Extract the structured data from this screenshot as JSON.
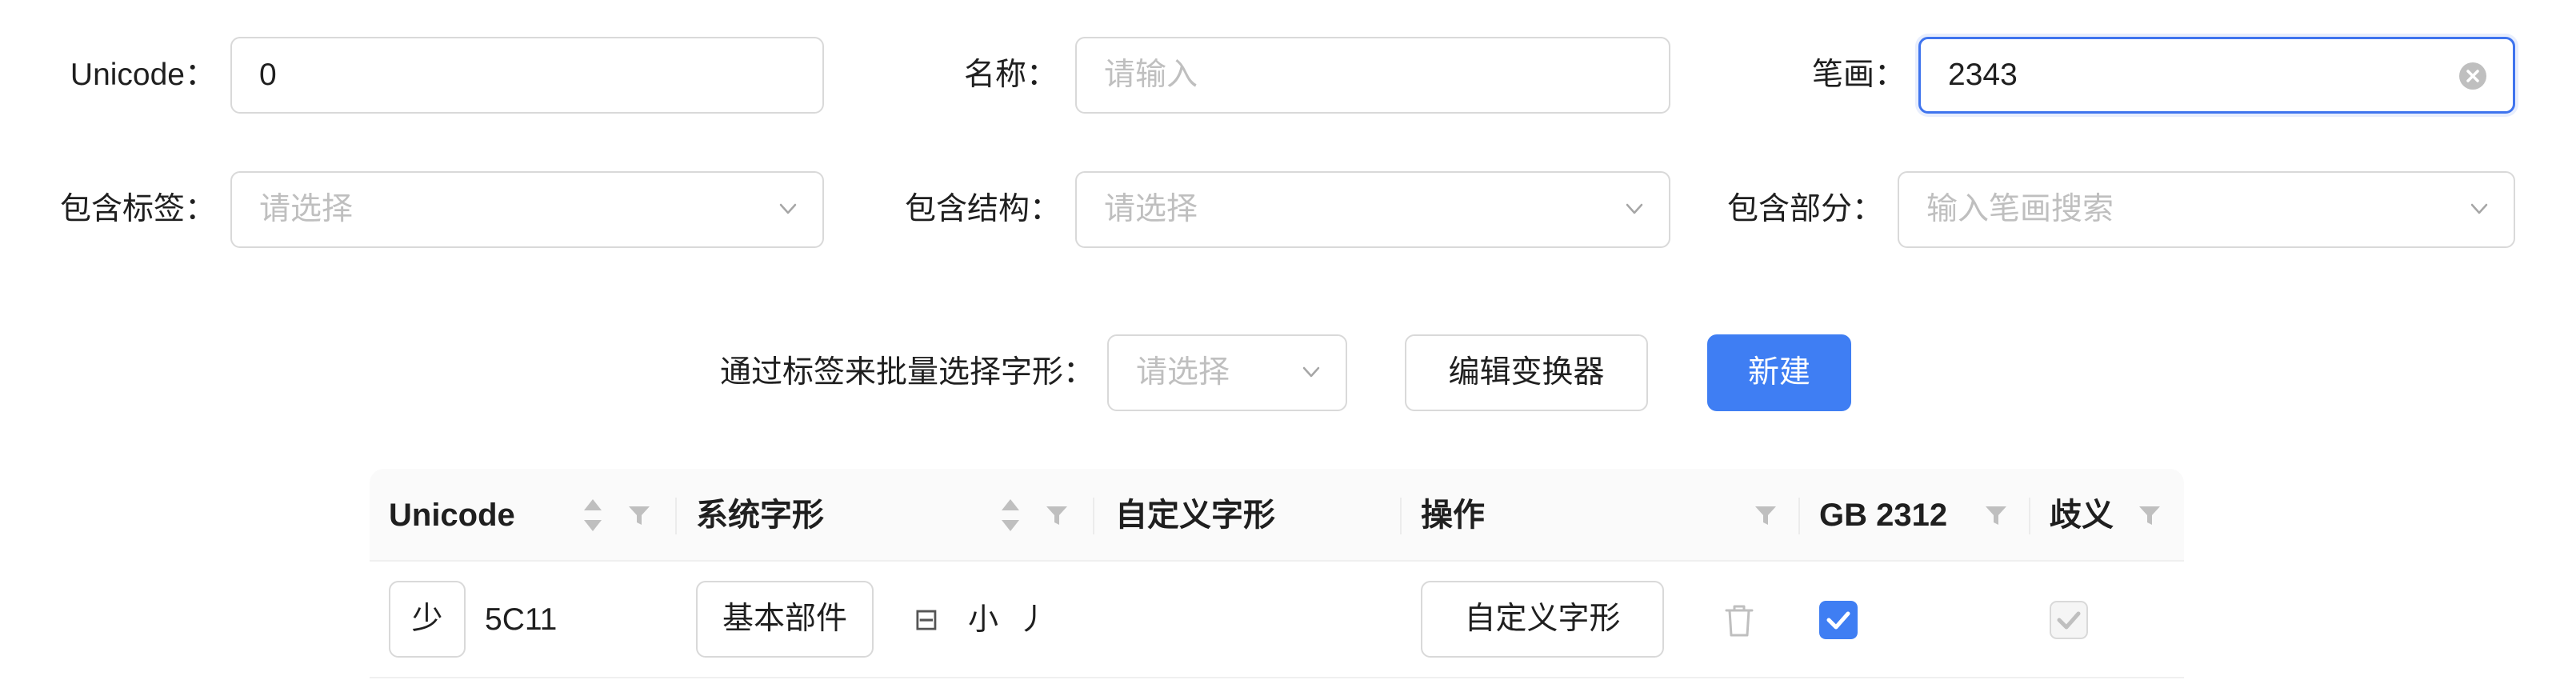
{
  "filters": {
    "unicode_label": "Unicode：",
    "unicode_value": "0",
    "name_label": "名称：",
    "name_placeholder": "请输入",
    "stroke_label": "笔画：",
    "stroke_value": "2343",
    "tags_label": "包含标签：",
    "tags_placeholder": "请选择",
    "structure_label": "包含结构：",
    "structure_placeholder": "请选择",
    "parts_label": "包含部分：",
    "parts_placeholder": "输入笔画搜索"
  },
  "toolbar": {
    "batch_label": "通过标签来批量选择字形：",
    "batch_placeholder": "请选择",
    "edit_transformer_label": "编辑变换器",
    "new_label": "新建"
  },
  "table": {
    "columns": [
      "Unicode",
      "系统字形",
      "自定义字形",
      "操作",
      "GB 2312",
      "歧义"
    ],
    "rows": [
      {
        "char": "少",
        "unicode": "5C11",
        "glyph_type": "基本部件",
        "strokes": [
          "⊟",
          "小",
          "丿"
        ],
        "action_label": "自定义字形",
        "gb2312": true,
        "ambiguous": true
      }
    ]
  },
  "colors": {
    "primary": "#3f7ef3",
    "focus_border": "#3f74ee",
    "border": "#d9d9d9",
    "placeholder": "#bfbfbf",
    "header_bg": "#fafafa"
  },
  "icons": [
    "clear-icon",
    "chevron-down-icon",
    "sort-icon",
    "filter-icon",
    "trash-icon",
    "checkbox-checked"
  ]
}
